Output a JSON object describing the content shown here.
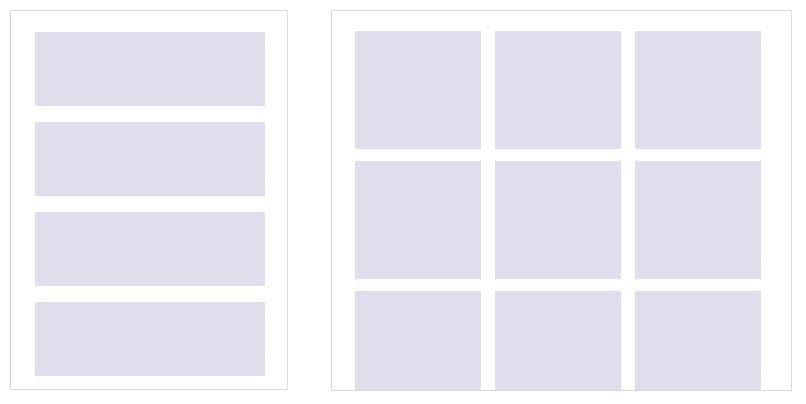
{
  "colors": {
    "placeholder_fill": "#dfdeec",
    "panel_border": "#d9d9df",
    "background": "#ffffff"
  },
  "left_panel": {
    "block_count": 4
  },
  "right_panel": {
    "grid_rows": 3,
    "grid_columns": 3
  }
}
